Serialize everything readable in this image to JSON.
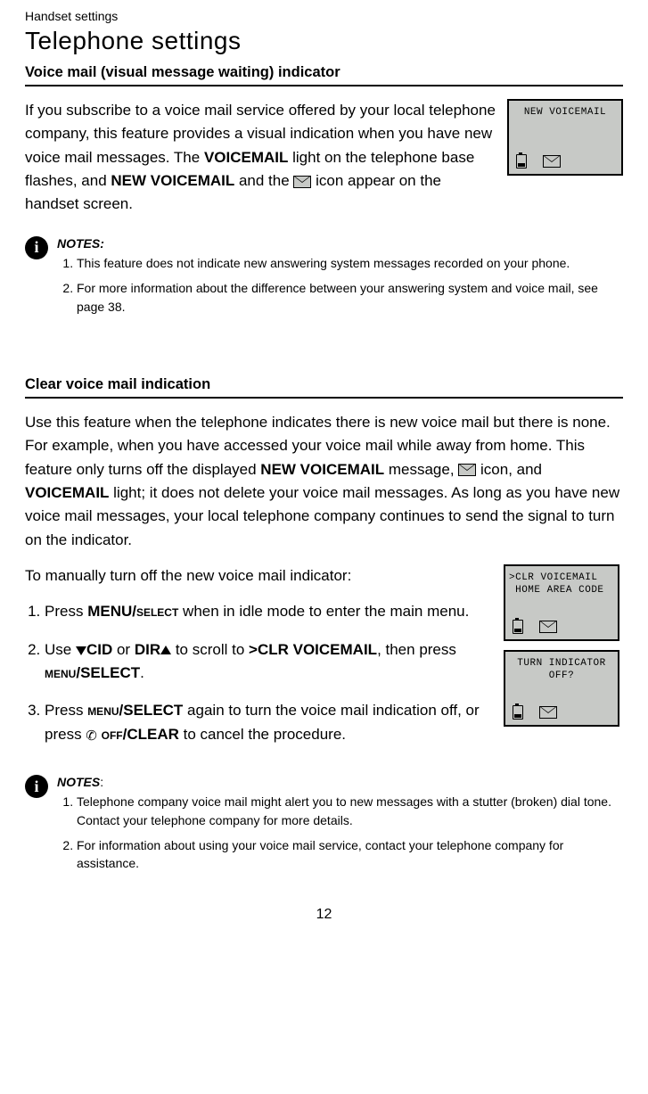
{
  "header": {
    "category": "Handset settings",
    "title": "Telephone settings"
  },
  "section1": {
    "heading": "Voice mail (visual message waiting) indicator",
    "p_pre": "If you subscribe to a voice mail service offered by your local telephone company, this feature provides a visual indication when you have new voice mail messages. The ",
    "p_b1": "VOICEMAIL",
    "p_mid1": " light on the telephone base flashes, and ",
    "p_b2": "NEW VOICEMAIL",
    "p_mid2": " and the ",
    "p_post": " icon appear on the handset screen.",
    "lcd": {
      "line1": "NEW VOICEMAIL",
      "line2": ""
    },
    "notes_label": "NOTES:",
    "note1": "This feature does not indicate new answering system messages recorded on your phone.",
    "note2": "For more information about the difference between your answering system and voice mail, see page 38."
  },
  "section2": {
    "heading": "Clear voice mail indication",
    "para2_a": "Use this feature when the telephone indicates there is new voice mail but there is none. For example, when you have accessed your voice mail while away from home. This feature only turns off the displayed ",
    "para2_b1": "NEW VOICEMAIL",
    "para2_b": " message, ",
    "para2_c": " icon, and ",
    "para2_b2": "VOICEMAIL",
    "para2_d": " light; it does not delete your voice mail messages. As long as you have new voice mail messages, your local telephone company continues to send the signal to turn on the indicator.",
    "para3": "To manually turn off the new voice mail indicator:",
    "lcdA": {
      "line1": ">CLR VOICEMAIL",
      "line2": " HOME AREA CODE"
    },
    "lcdB": {
      "line1": "TURN INDICATOR",
      "line2": "OFF?"
    },
    "step1_a": "Press ",
    "step1_b": "MENU/",
    "step1_sc": "select",
    "step1_c": " when in idle mode to enter the main menu.",
    "step2_a": "Use ",
    "step2_cid": "CID",
    "step2_b": " or ",
    "step2_dir": "DIR",
    "step2_c": " to scroll to ",
    "step2_bold": ">CLR VOICEMAIL",
    "step2_d": ", then press ",
    "step2_menu_sc": "menu",
    "step2_sel": "/SELECT",
    "step2_e": ".",
    "step3_a": "Press ",
    "step3_menu_sc": "menu",
    "step3_sel": "/SELECT",
    "step3_b": " again to turn the voice mail indication off, or press   ",
    "step3_off_sc": "off",
    "step3_clear": "/CLEAR",
    "step3_c": " to cancel the procedure.",
    "notes_label": "NOTES",
    "notes_colon": ":",
    "note1": "Telephone company voice mail might alert you to new messages with a stutter (broken) dial tone. Contact your telephone company for more details.",
    "note2": "For information about using your voice mail service, contact your telephone company for assistance."
  },
  "page_number": "12"
}
